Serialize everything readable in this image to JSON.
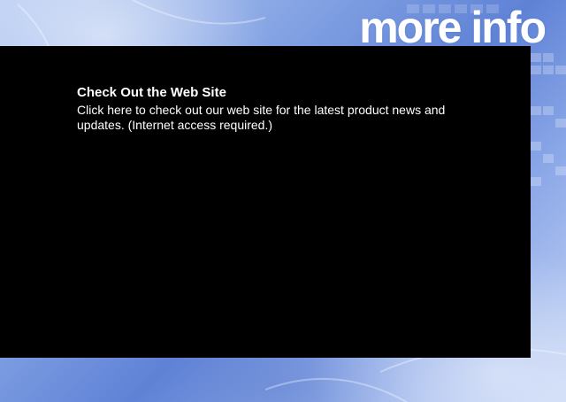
{
  "header": {
    "title": "more info"
  },
  "panel": {
    "link": {
      "title": "Check Out the Web Site",
      "description": "Click here to check out our web site for the latest product news and updates. (Internet access required.)"
    }
  },
  "colors": {
    "panel_background": "#000000",
    "text": "#ffffff",
    "backdrop_blue": "#7f9fe2"
  }
}
